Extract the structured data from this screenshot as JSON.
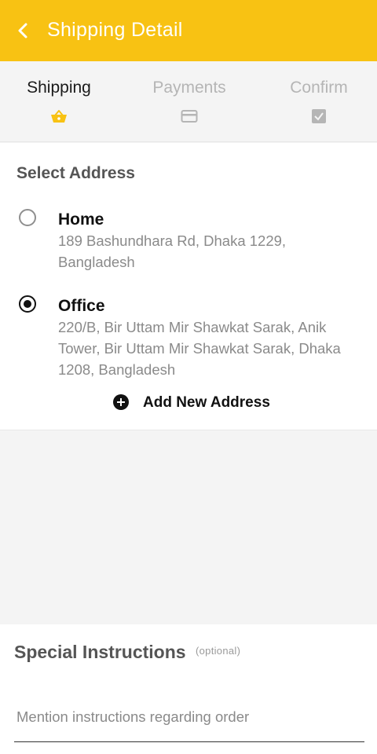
{
  "app_bar": {
    "title": "Shipping Detail",
    "back_icon": "chevron-left-icon",
    "background_color": "#f8c213"
  },
  "steps": [
    {
      "label": "Shipping",
      "icon": "basket-icon",
      "active": true
    },
    {
      "label": "Payments",
      "icon": "credit-card-icon",
      "active": false
    },
    {
      "label": "Confirm",
      "icon": "checkbox-icon",
      "active": false
    }
  ],
  "address_section": {
    "heading": "Select Address",
    "addresses": [
      {
        "name": "Home",
        "line": "189 Bashundhara Rd, Dhaka 1229, Bangladesh",
        "selected": false
      },
      {
        "name": "Office",
        "line": "220/B, Bir Uttam Mir Shawkat Sarak, Anik Tower, Bir Uttam Mir Shawkat Sarak, Dhaka 1208, Bangladesh",
        "selected": true
      }
    ],
    "add_button_label": "Add New Address"
  },
  "special_instructions": {
    "title": "Special Instructions",
    "optional_label": "(optional)",
    "placeholder": "Mention instructions regarding order",
    "value": ""
  }
}
